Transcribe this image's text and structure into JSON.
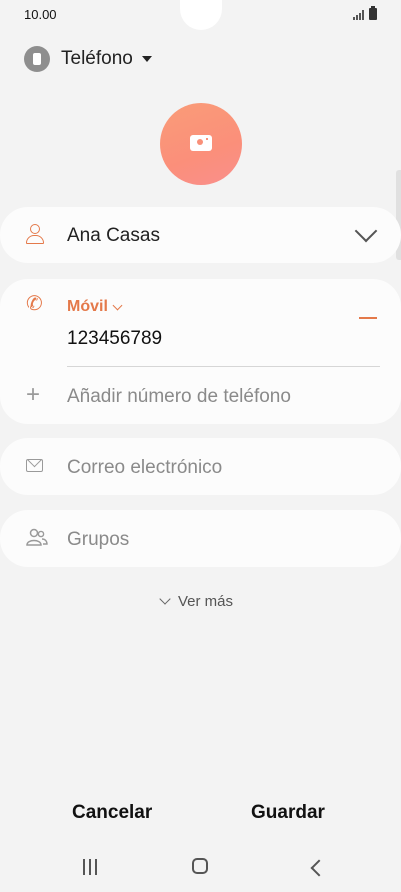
{
  "status_bar": {
    "time": "10.00"
  },
  "account": {
    "label": "Teléfono"
  },
  "contact": {
    "name": "Ana Casas",
    "phone_type": "Móvil",
    "phone_number": "123456789",
    "add_phone_label": "Añadir número de teléfono",
    "email_placeholder": "Correo electrónico",
    "groups_placeholder": "Grupos"
  },
  "see_more_label": "Ver más",
  "actions": {
    "cancel_label": "Cancelar",
    "save_label": "Guardar"
  },
  "colors": {
    "accent": "#e4794a",
    "photo_gradient": "#fb8f7a",
    "background": "#f3f3f3",
    "card": "#fcfcfc"
  },
  "icons": [
    "signal-icon",
    "battery-icon",
    "phone-account-icon",
    "caret-down-icon",
    "camera-icon",
    "person-icon",
    "chevron-down-icon",
    "phone-icon",
    "minus-icon",
    "plus-icon",
    "email-icon",
    "groups-icon",
    "recents-icon",
    "home-icon",
    "back-icon"
  ]
}
